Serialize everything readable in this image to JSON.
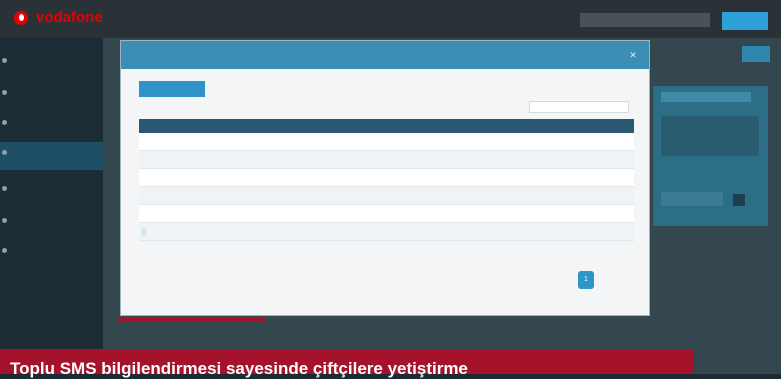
{
  "app": {
    "brand": "vodafone",
    "user_label": "",
    "top_button": ""
  },
  "sidebar": {
    "items": [
      {
        "label": ""
      },
      {
        "label": ""
      },
      {
        "label": ""
      },
      {
        "label": ""
      },
      {
        "label": ""
      },
      {
        "label": ""
      },
      {
        "label": ""
      }
    ]
  },
  "modal": {
    "title": "",
    "tab_label": "",
    "search_label": "",
    "search_placeholder": "",
    "columns": [
      "",
      "",
      "",
      "",
      "",
      "",
      "",
      ""
    ],
    "rows": [
      [
        "",
        "",
        "",
        "",
        "",
        "",
        "",
        ""
      ],
      [
        "",
        "",
        "",
        "",
        "",
        "",
        "",
        ""
      ],
      [
        "",
        "",
        "",
        "",
        "",
        "",
        "",
        ""
      ],
      [
        "",
        "",
        "",
        "",
        "",
        "",
        "",
        ""
      ],
      [
        "",
        "",
        "",
        "",
        "",
        "",
        "",
        ""
      ],
      [
        "",
        "",
        "",
        "",
        "",
        "",
        "",
        ""
      ]
    ],
    "pagination": {
      "info": "",
      "prev": "",
      "current": "1",
      "next": ""
    }
  },
  "page": {
    "link_text": ""
  },
  "banner": {
    "text": "Toplu SMS bilgilendirmesi sayesinde çiftçilere yetiştirme"
  },
  "colors": {
    "brand_red": "#e60000",
    "accent_blue": "#2f95c8",
    "banner_red": "#a4132a",
    "header_dark": "#2b5873"
  }
}
